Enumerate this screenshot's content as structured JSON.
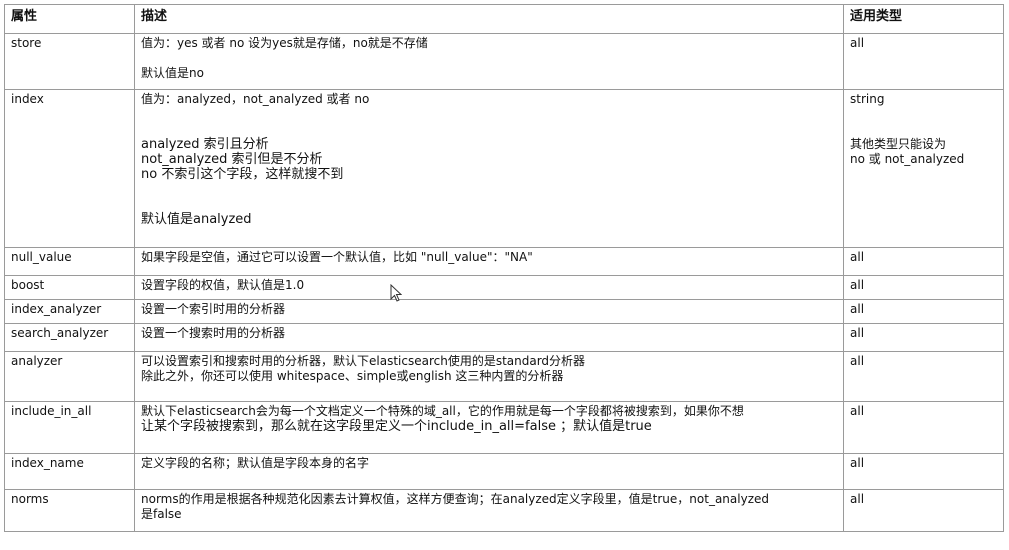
{
  "headers": {
    "attr": "属性",
    "desc": "描述",
    "type": "适用类型"
  },
  "rows": [
    {
      "attr": "store",
      "desc": [
        "值为：yes 或者 no  设为yes就是存储，no就是不存储",
        "",
        "默认值是no"
      ],
      "type": [
        "all"
      ]
    },
    {
      "attr": "index",
      "desc": [
        "值为：analyzed，not_analyzed 或者 no",
        "",
        "",
        "analyzed 索引且分析",
        "not_analyzed 索引但是不分析",
        "no 不索引这个字段，这样就搜不到",
        "",
        "",
        "默认值是analyzed"
      ],
      "type": [
        "string",
        "",
        "",
        "其他类型只能设为",
        "no 或 not_analyzed"
      ]
    },
    {
      "attr": "null_value",
      "desc": [
        "如果字段是空值，通过它可以设置一个默认值，比如 \"null_value\"：\"NA\""
      ],
      "type": [
        "all"
      ]
    },
    {
      "attr": "boost",
      "desc": [
        "设置字段的权值，默认值是1.0"
      ],
      "type": [
        "all"
      ]
    },
    {
      "attr": "index_analyzer",
      "desc": [
        "设置一个索引时用的分析器"
      ],
      "type": [
        "all"
      ]
    },
    {
      "attr": "search_analyzer",
      "desc": [
        "设置一个搜索时用的分析器"
      ],
      "type": [
        "all"
      ]
    },
    {
      "attr": "analyzer",
      "desc": [
        "可以设置索引和搜索时用的分析器，默认下elasticsearch使用的是standard分析器",
        "除此之外，你还可以使用 whitespace、simple或english 这三种内置的分析器"
      ],
      "type": [
        "all"
      ]
    },
    {
      "attr": "include_in_all",
      "desc": [
        "默认下elasticsearch会为每一个文档定义一个特殊的域_all，它的作用就是每一个字段都将被搜索到，如果你不想",
        "让某个字段被搜索到，那么就在这字段里定义一个include_in_all=false ；默认值是true"
      ],
      "type": [
        "all"
      ]
    },
    {
      "attr": "index_name",
      "desc": [
        "定义字段的名称；默认值是字段本身的名字"
      ],
      "type": [
        "all"
      ]
    },
    {
      "attr": "norms",
      "desc": [
        "norms的作用是根据各种规范化因素去计算权值，这样方便查询；在analyzed定义字段里，值是true，not_analyzed",
        "是false"
      ],
      "type": [
        "all"
      ]
    }
  ],
  "icons": {
    "cursor": "mouse-pointer-icon"
  }
}
